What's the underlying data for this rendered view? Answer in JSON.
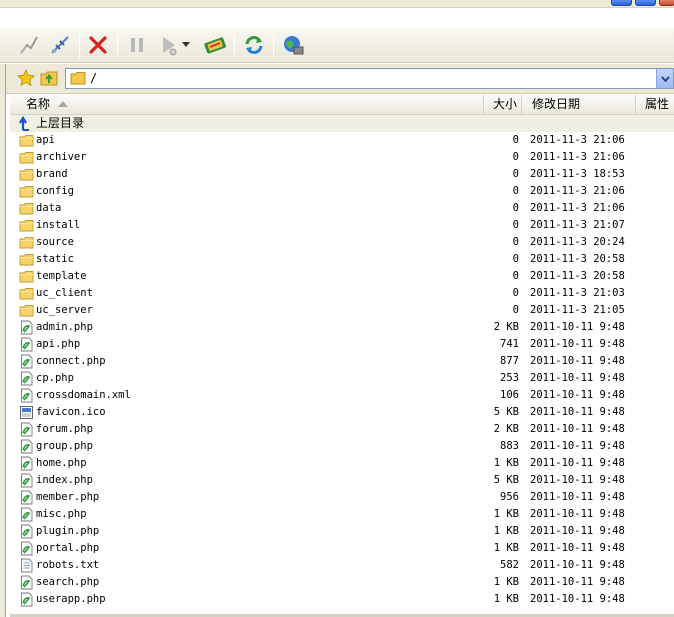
{
  "address": {
    "path": "/"
  },
  "columns": {
    "name": "名称",
    "size": "大小",
    "modified": "修改日期",
    "attr": "属性"
  },
  "parent_dir": "上层目录",
  "files": [
    {
      "name": "api",
      "size": "0",
      "date": "2011-11-3 21:06",
      "type": "folder"
    },
    {
      "name": "archiver",
      "size": "0",
      "date": "2011-11-3 21:06",
      "type": "folder"
    },
    {
      "name": "brand",
      "size": "0",
      "date": "2011-11-3 18:53",
      "type": "folder"
    },
    {
      "name": "config",
      "size": "0",
      "date": "2011-11-3 21:06",
      "type": "folder"
    },
    {
      "name": "data",
      "size": "0",
      "date": "2011-11-3 21:06",
      "type": "folder"
    },
    {
      "name": "install",
      "size": "0",
      "date": "2011-11-3 21:07",
      "type": "folder"
    },
    {
      "name": "source",
      "size": "0",
      "date": "2011-11-3 20:24",
      "type": "folder"
    },
    {
      "name": "static",
      "size": "0",
      "date": "2011-11-3 20:58",
      "type": "folder"
    },
    {
      "name": "template",
      "size": "0",
      "date": "2011-11-3 20:58",
      "type": "folder"
    },
    {
      "name": "uc_client",
      "size": "0",
      "date": "2011-11-3 21:03",
      "type": "folder"
    },
    {
      "name": "uc_server",
      "size": "0",
      "date": "2011-11-3 21:05",
      "type": "folder"
    },
    {
      "name": "admin.php",
      "size": "2 KB",
      "date": "2011-10-11 9:48",
      "type": "php"
    },
    {
      "name": "api.php",
      "size": "741",
      "date": "2011-10-11 9:48",
      "type": "php"
    },
    {
      "name": "connect.php",
      "size": "877",
      "date": "2011-10-11 9:48",
      "type": "php"
    },
    {
      "name": "cp.php",
      "size": "253",
      "date": "2011-10-11 9:48",
      "type": "php"
    },
    {
      "name": "crossdomain.xml",
      "size": "106",
      "date": "2011-10-11 9:48",
      "type": "php"
    },
    {
      "name": "favicon.ico",
      "size": "5 KB",
      "date": "2011-10-11 9:48",
      "type": "ico"
    },
    {
      "name": "forum.php",
      "size": "2 KB",
      "date": "2011-10-11 9:48",
      "type": "php"
    },
    {
      "name": "group.php",
      "size": "883",
      "date": "2011-10-11 9:48",
      "type": "php"
    },
    {
      "name": "home.php",
      "size": "1 KB",
      "date": "2011-10-11 9:48",
      "type": "php"
    },
    {
      "name": "index.php",
      "size": "5 KB",
      "date": "2011-10-11 9:48",
      "type": "php"
    },
    {
      "name": "member.php",
      "size": "956",
      "date": "2011-10-11 9:48",
      "type": "php"
    },
    {
      "name": "misc.php",
      "size": "1 KB",
      "date": "2011-10-11 9:48",
      "type": "php"
    },
    {
      "name": "plugin.php",
      "size": "1 KB",
      "date": "2011-10-11 9:48",
      "type": "php"
    },
    {
      "name": "portal.php",
      "size": "1 KB",
      "date": "2011-10-11 9:48",
      "type": "php"
    },
    {
      "name": "robots.txt",
      "size": "582",
      "date": "2011-10-11 9:48",
      "type": "txt"
    },
    {
      "name": "search.php",
      "size": "1 KB",
      "date": "2011-10-11 9:48",
      "type": "php"
    },
    {
      "name": "userapp.php",
      "size": "1 KB",
      "date": "2011-10-11 9:48",
      "type": "php"
    }
  ],
  "icons": {
    "toolbar": [
      "connect-icon",
      "disconnect-icon",
      "cancel-icon",
      "pause-icon",
      "play-icon",
      "transfer-icon",
      "refresh-icon",
      "site-manager-icon"
    ],
    "folder": "folder-icon",
    "php": "script-file-icon",
    "ico": "image-file-icon",
    "txt": "text-file-icon",
    "parent": "up-arrow-icon"
  },
  "colors": {
    "folder": "#f2c94c",
    "accent": "#316ac5",
    "danger": "#d6231f"
  }
}
